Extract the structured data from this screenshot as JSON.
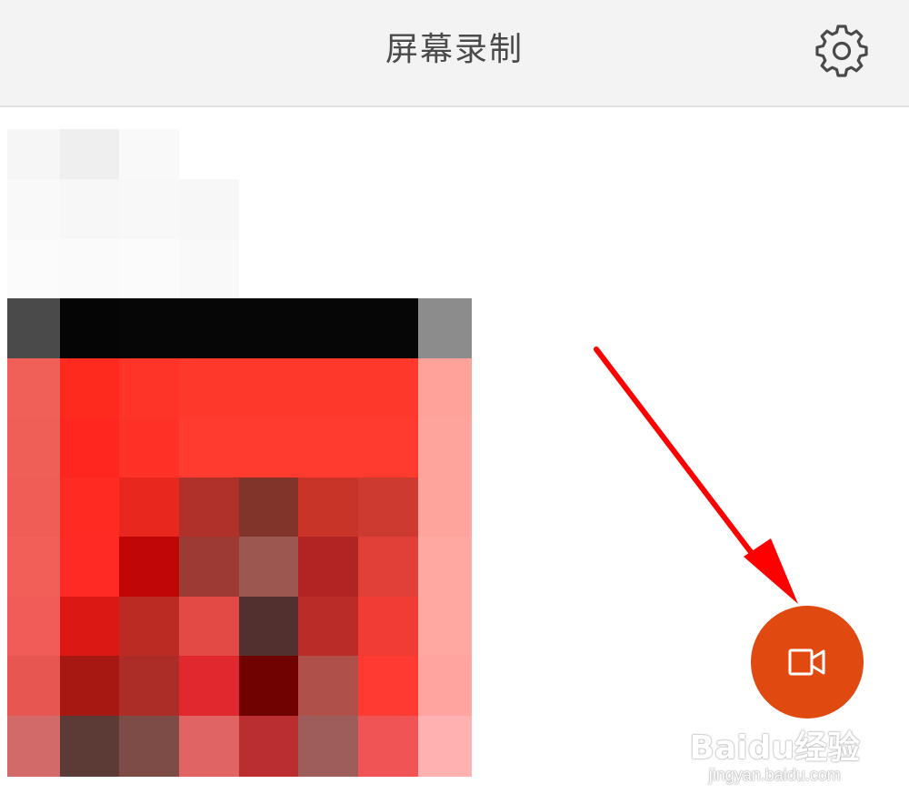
{
  "header": {
    "title": "屏幕录制",
    "settings_icon": "gear-icon"
  },
  "recording_thumbnail": {
    "description_icon": "pixelated-thumbnail"
  },
  "fab": {
    "icon": "video-camera-icon",
    "color": "#e04a10"
  },
  "annotation": {
    "arrow_color": "#ff0000"
  },
  "watermark": {
    "brand": "Baidu经验",
    "url": "jingyan.baidu.com"
  },
  "colors": {
    "header_bg": "#f3f3f3",
    "title_text": "#4a4a4a",
    "accent": "#e04a10"
  }
}
